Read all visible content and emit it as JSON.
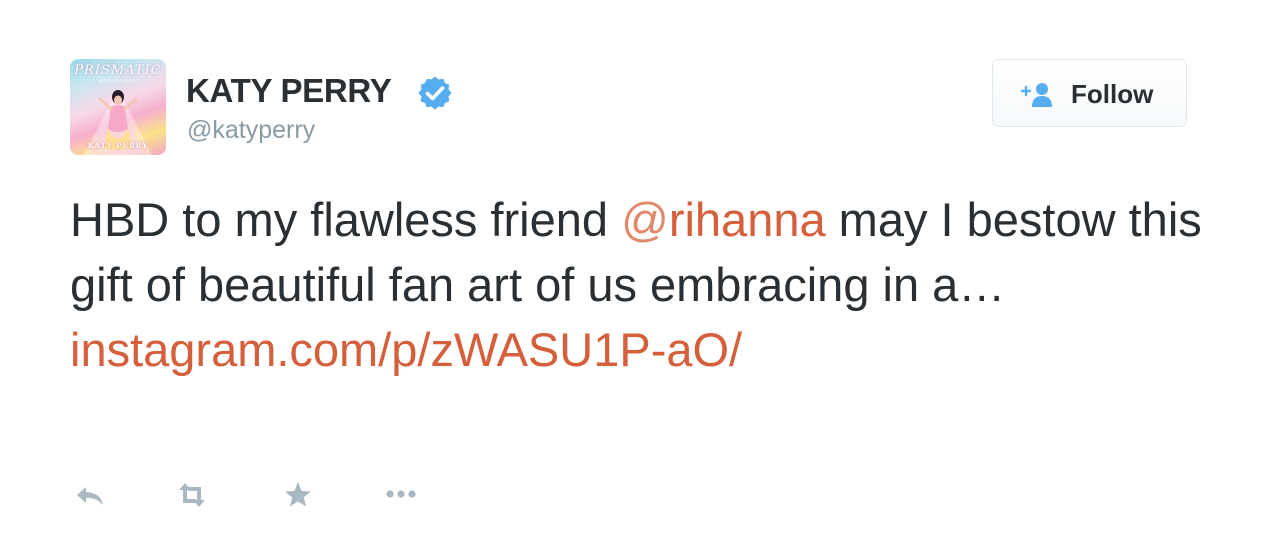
{
  "user": {
    "display_name": "KATY PERRY",
    "screen_name": "@katyperry",
    "verified": true,
    "avatar": {
      "title": "PRISMATIC",
      "subtitle": "WORLD TOUR",
      "name": "KATY PERRY"
    }
  },
  "follow_button": {
    "label": "Follow",
    "icon": "follow-person-plus-icon"
  },
  "tweet": {
    "text_before": "HBD to my flawless friend ",
    "mention_at": "@",
    "mention_name": "rihanna",
    "text_after": " may I bestow this gift of beautiful fan art of us embracing in a…",
    "link": "instagram.com/p/zWASU1P-aO/"
  },
  "actions": [
    {
      "name": "reply",
      "icon": "reply-icon"
    },
    {
      "name": "retweet",
      "icon": "retweet-icon"
    },
    {
      "name": "favorite",
      "icon": "star-icon"
    },
    {
      "name": "more",
      "icon": "more-dots-icon"
    }
  ],
  "colors": {
    "text": "#292f33",
    "secondary": "#8899a6",
    "link": "#d55e3b",
    "verified": "#55acee",
    "icon": "#aab8c2"
  }
}
